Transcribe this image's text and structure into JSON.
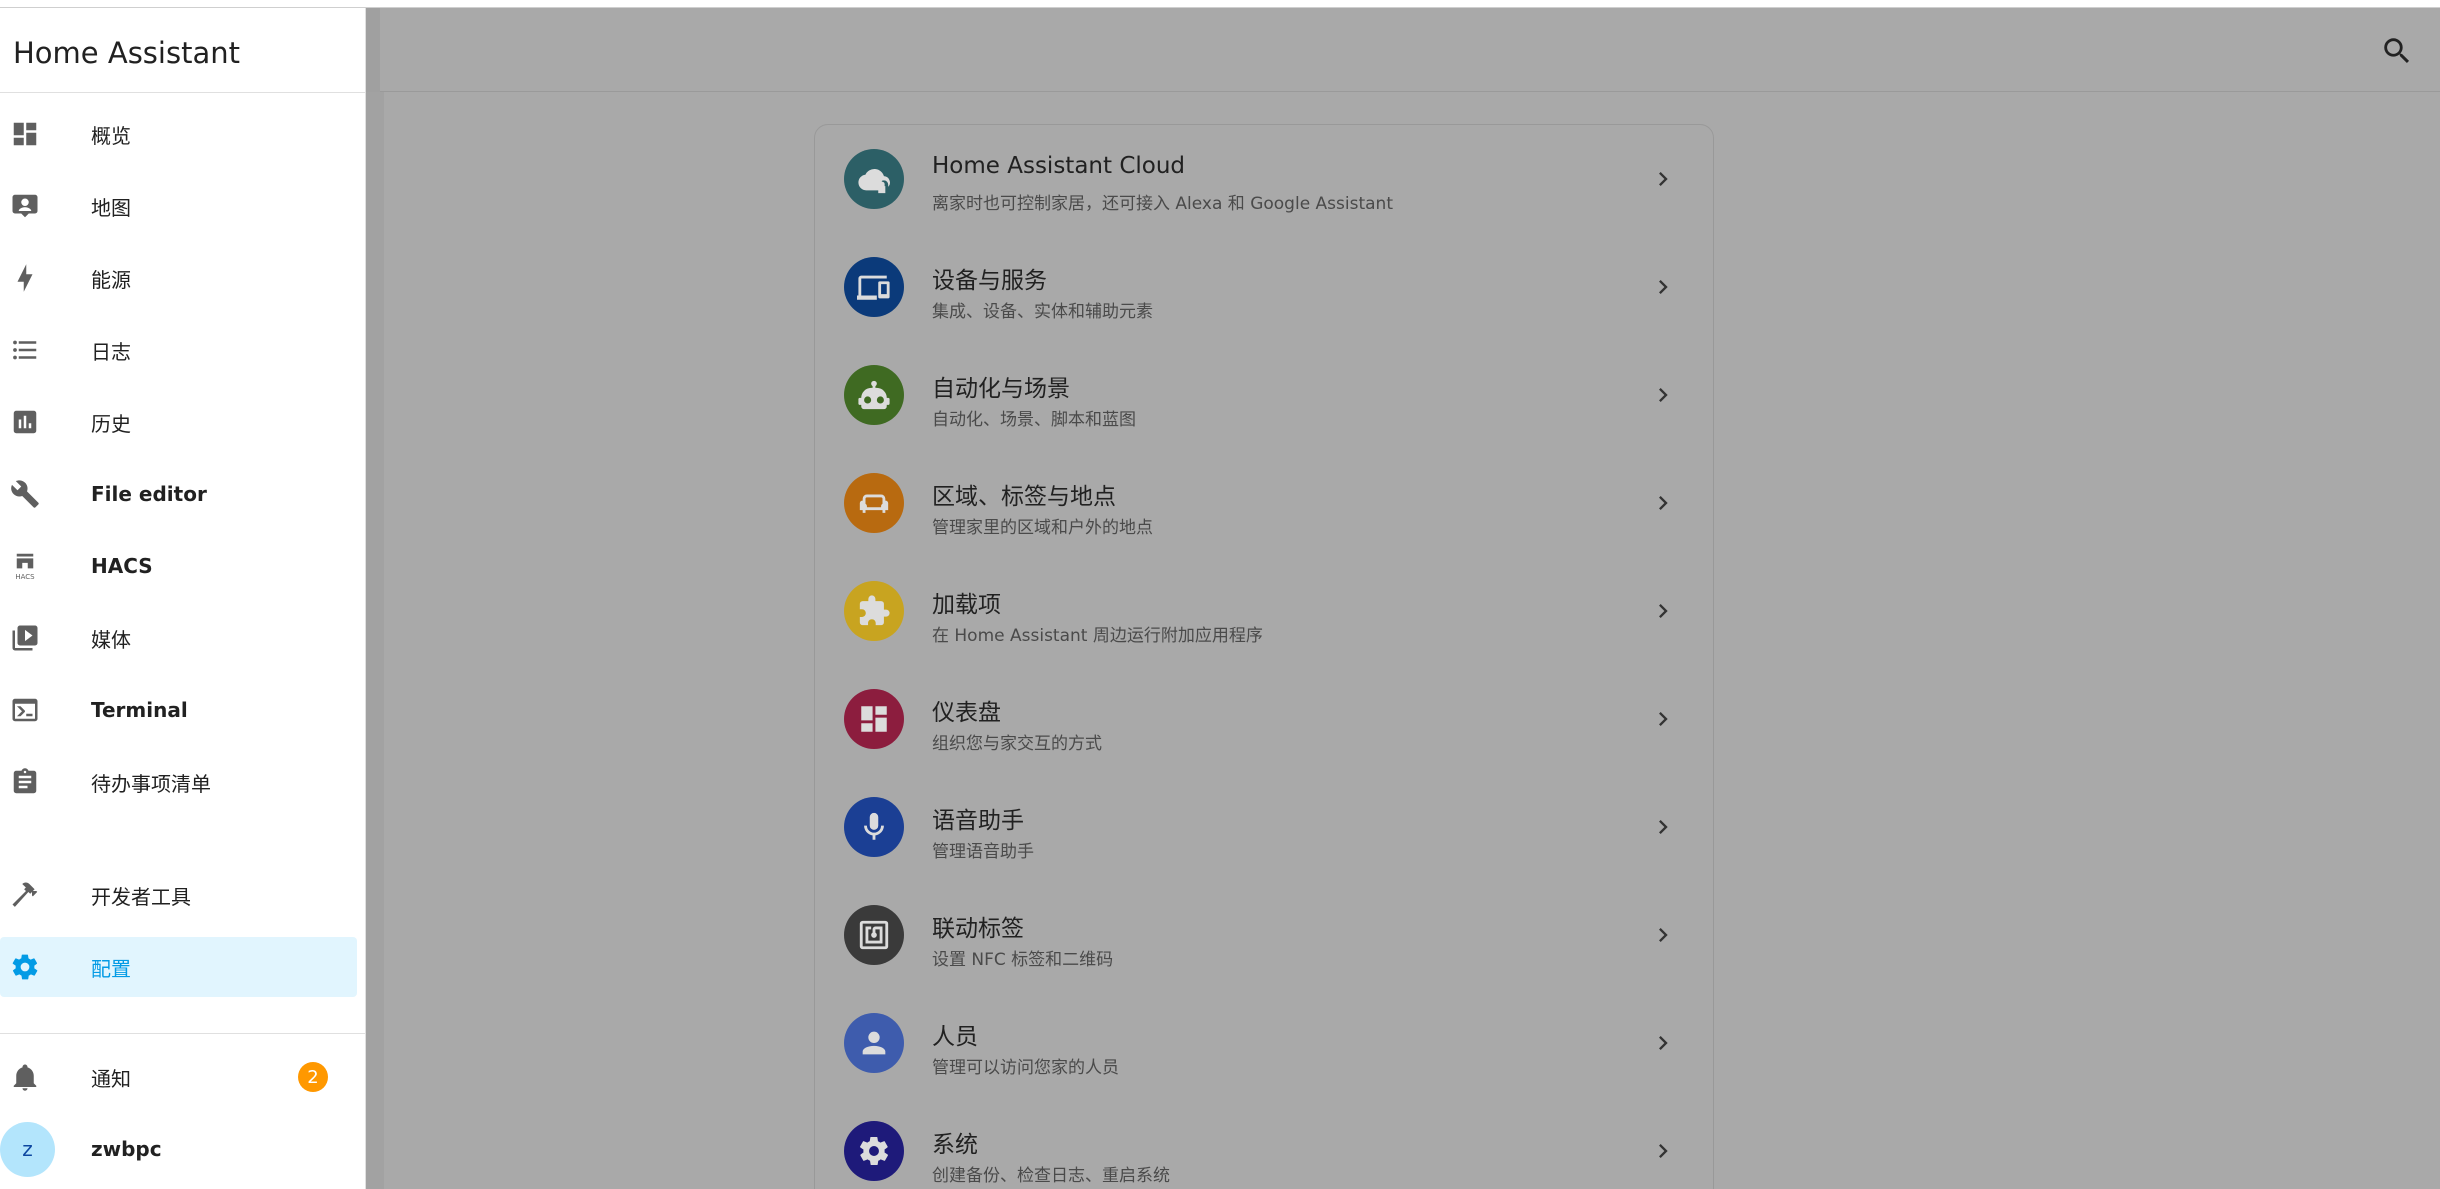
{
  "app": {
    "title": "Home Assistant"
  },
  "sidebar": {
    "items": [
      {
        "label": "概览",
        "icon": "dashboard-icon"
      },
      {
        "label": "地图",
        "icon": "map-account-icon"
      },
      {
        "label": "能源",
        "icon": "lightning-icon"
      },
      {
        "label": "日志",
        "icon": "format-list-icon"
      },
      {
        "label": "历史",
        "icon": "chart-box-icon"
      },
      {
        "label": "File editor",
        "icon": "wrench-icon"
      },
      {
        "label": "HACS",
        "icon": "hacs-icon",
        "icon_text": "HACS"
      },
      {
        "label": "媒体",
        "icon": "play-box-multiple-icon"
      },
      {
        "label": "Terminal",
        "icon": "console-icon"
      },
      {
        "label": "待办事项清单",
        "icon": "clipboard-list-icon"
      },
      {
        "label": "开发者工具",
        "icon": "hammer-icon"
      },
      {
        "label": "配置",
        "icon": "cog-icon",
        "active": true
      }
    ],
    "notifications": {
      "label": "通知",
      "count": "2",
      "icon": "bell-icon"
    },
    "user": {
      "name": "zwbpc",
      "initial": "z"
    }
  },
  "colors": {
    "accent": "#039be5",
    "active_bg": "#e1f5fe",
    "badge": "#ff9800",
    "overlay": "#a9a9a9"
  },
  "settings": {
    "rows": [
      {
        "title": "Home Assistant Cloud",
        "subtitle": "离家时也可控制家居，还可接入 Alexa 和 Google Assistant",
        "icon": "cloud-lock-icon",
        "color": "#2c5f66"
      },
      {
        "title": "设备与服务",
        "subtitle": "集成、设备、实体和辅助元素",
        "icon": "devices-icon",
        "color": "#0b3a7a"
      },
      {
        "title": "自动化与场景",
        "subtitle": "自动化、场景、脚本和蓝图",
        "icon": "robot-icon",
        "color": "#3f6a22"
      },
      {
        "title": "区域、标签与地点",
        "subtitle": "管理家里的区域和户外的地点",
        "icon": "sofa-icon",
        "color": "#b86a10"
      },
      {
        "title": "加载项",
        "subtitle": "在 Home Assistant 周边运行附加应用程序",
        "icon": "puzzle-icon",
        "color": "#c8a420"
      },
      {
        "title": "仪表盘",
        "subtitle": "组织您与家交互的方式",
        "icon": "view-dashboard-icon",
        "color": "#8c1d3e"
      },
      {
        "title": "语音助手",
        "subtitle": "管理语音助手",
        "icon": "microphone-icon",
        "color": "#1b3f94"
      },
      {
        "title": "联动标签",
        "subtitle": "设置 NFC 标签和二维码",
        "icon": "nfc-icon",
        "color": "#3a3a3a"
      },
      {
        "title": "人员",
        "subtitle": "管理可以访问您家的人员",
        "icon": "account-icon",
        "color": "#3e5cad"
      },
      {
        "title": "系统",
        "subtitle": "创建备份、检查日志、重启系统",
        "icon": "cog-icon",
        "color": "#1e1a7a"
      }
    ]
  }
}
